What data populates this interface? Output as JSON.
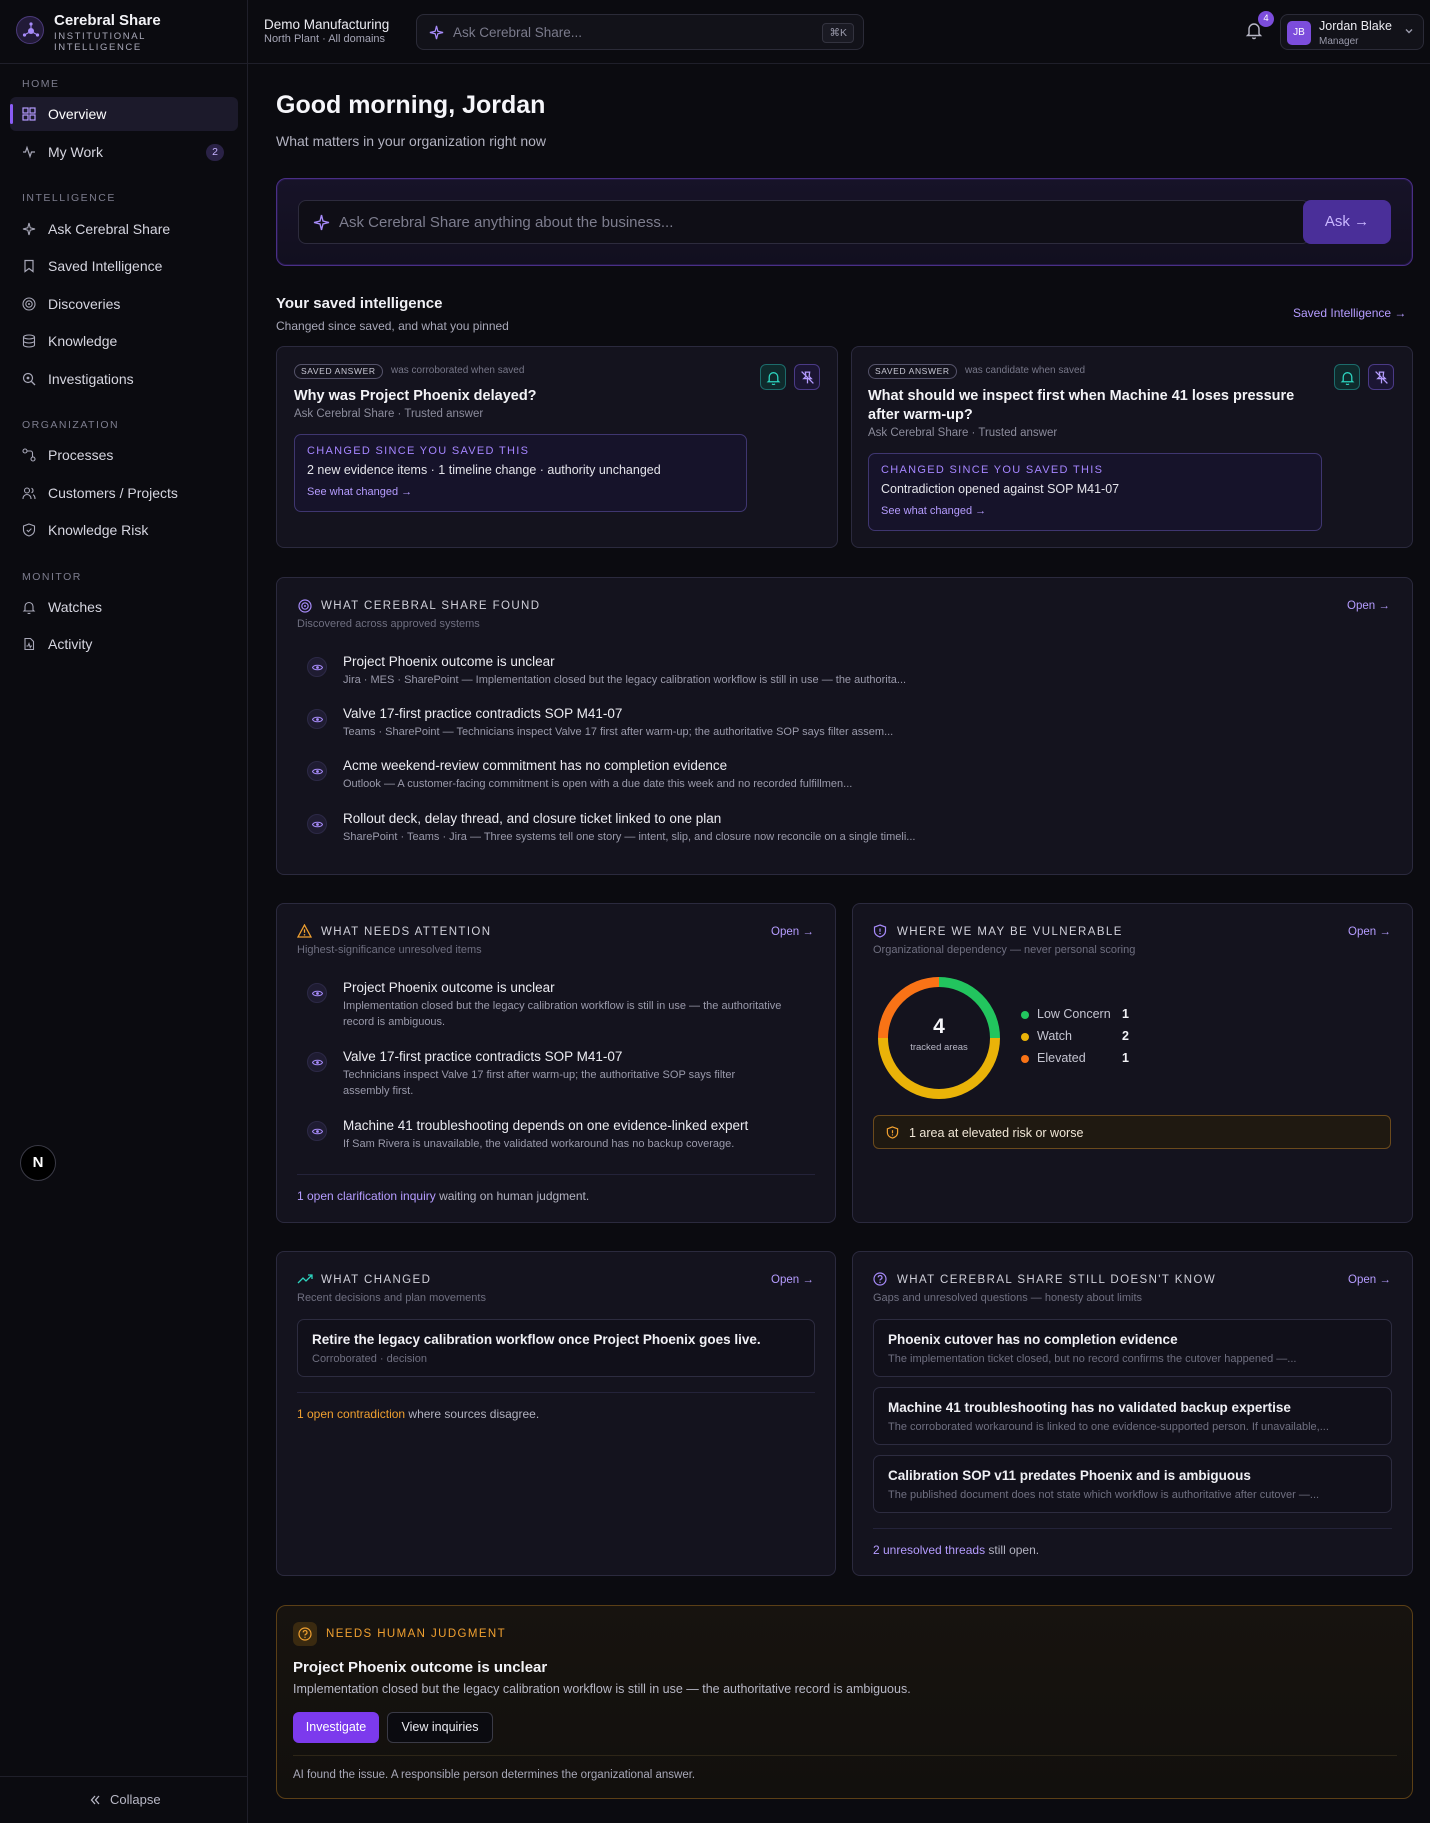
{
  "brand": {
    "name": "Cerebral Share",
    "subtitle": "INSTITUTIONAL INTELLIGENCE"
  },
  "org": {
    "name": "Demo Manufacturing",
    "scope": "North Plant · All domains"
  },
  "search": {
    "placeholder": "Ask Cerebral Share...",
    "shortcut": "⌘K"
  },
  "notifications": {
    "count": "4"
  },
  "user": {
    "initials": "JB",
    "name": "Jordan Blake",
    "role": "Manager"
  },
  "sidebar": {
    "sections": [
      {
        "label": "HOME"
      },
      {
        "label": "INTELLIGENCE"
      },
      {
        "label": "ORGANIZATION"
      },
      {
        "label": "MONITOR"
      }
    ],
    "items": [
      {
        "label": "Overview",
        "icon": "grid-icon"
      },
      {
        "label": "My Work",
        "icon": "activity-icon",
        "badge": "2"
      },
      {
        "label": "Ask Cerebral Share",
        "icon": "sparkle-icon"
      },
      {
        "label": "Saved Intelligence",
        "icon": "bookmark-icon"
      },
      {
        "label": "Discoveries",
        "icon": "radar-icon"
      },
      {
        "label": "Knowledge",
        "icon": "database-icon"
      },
      {
        "label": "Investigations",
        "icon": "search-icon"
      },
      {
        "label": "Processes",
        "icon": "workflow-icon"
      },
      {
        "label": "Customers / Projects",
        "icon": "users-icon"
      },
      {
        "label": "Knowledge Risk",
        "icon": "shield-icon"
      },
      {
        "label": "Watches",
        "icon": "bell-icon"
      },
      {
        "label": "Activity",
        "icon": "file-activity-icon"
      }
    ],
    "collapse_label": "Collapse",
    "next_badge": "N"
  },
  "greeting": {
    "title": "Good morning, Jordan",
    "subtitle": "What matters in your organization right now"
  },
  "ask": {
    "placeholder": "Ask Cerebral Share anything about the business...",
    "button": "Ask →"
  },
  "saved": {
    "title": "Your saved intelligence",
    "subtitle": "Changed since saved, and what you pinned",
    "link": "Saved Intelligence →",
    "cards": [
      {
        "pill": "SAVED ANSWER",
        "note": "was corroborated when saved",
        "title": "Why was Project Phoenix delayed?",
        "source": "Ask Cerebral Share · Trusted answer",
        "changed_heading": "CHANGED SINCE YOU SAVED THIS",
        "changed_text": "2 new evidence items · 1 timeline change · authority unchanged",
        "changed_link": "See what changed →"
      },
      {
        "pill": "SAVED ANSWER",
        "note": "was candidate when saved",
        "title": "What should we inspect first when Machine 41 loses pressure after warm-up?",
        "source": "Ask Cerebral Share · Trusted answer",
        "changed_heading": "CHANGED SINCE YOU SAVED THIS",
        "changed_text": "Contradiction opened against SOP M41-07",
        "changed_link": "See what changed →"
      }
    ]
  },
  "found": {
    "heading": "WHAT CEREBRAL SHARE FOUND",
    "subtitle": "Discovered across approved systems",
    "open": "Open →",
    "items": [
      {
        "title": "Project Phoenix outcome is unclear",
        "desc": "Jira · MES · SharePoint — Implementation closed but the legacy calibration workflow is still in use — the authorita..."
      },
      {
        "title": "Valve 17-first practice contradicts SOP M41-07",
        "desc": "Teams · SharePoint — Technicians inspect Valve 17 first after warm-up; the authoritative SOP says filter assem..."
      },
      {
        "title": "Acme weekend-review commitment has no completion evidence",
        "desc": "Outlook — A customer-facing commitment is open with a due date this week and no recorded fulfillmen..."
      },
      {
        "title": "Rollout deck, delay thread, and closure ticket linked to one plan",
        "desc": "SharePoint · Teams · Jira — Three systems tell one story — intent, slip, and closure now reconcile on a single timeli..."
      }
    ]
  },
  "attention": {
    "heading": "WHAT NEEDS ATTENTION",
    "subtitle": "Highest-significance unresolved items",
    "open": "Open →",
    "items": [
      {
        "title": "Project Phoenix outcome is unclear",
        "desc": "Implementation closed but the legacy calibration workflow is still in use — the authoritative record is ambiguous."
      },
      {
        "title": "Valve 17-first practice contradicts SOP M41-07",
        "desc": "Technicians inspect Valve 17 first after warm-up; the authoritative SOP says filter assembly first."
      },
      {
        "title": "Machine 41 troubleshooting depends on one evidence-linked expert",
        "desc": "If Sam Rivera is unavailable, the validated workaround has no backup coverage."
      }
    ],
    "foot_link": "1 open clarification inquiry",
    "foot_text": " waiting on human judgment."
  },
  "vulnerable": {
    "heading": "WHERE WE MAY BE VULNERABLE",
    "subtitle": "Organizational dependency — never personal scoring",
    "open": "Open →",
    "total": "4",
    "total_label": "tracked areas",
    "alert": "1 area at elevated risk or worse",
    "segments": [
      {
        "name": "Low Concern",
        "count": 1,
        "color": "#22c55e"
      },
      {
        "name": "Watch",
        "count": 2,
        "color": "#eab308"
      },
      {
        "name": "Elevated",
        "count": 1,
        "color": "#f97316"
      }
    ]
  },
  "changed": {
    "heading": "WHAT CHANGED",
    "subtitle": "Recent decisions and plan movements",
    "open": "Open →",
    "items": [
      {
        "title": "Retire the legacy calibration workflow once Project Phoenix goes live.",
        "desc": "Corroborated · decision"
      }
    ],
    "foot_link": "1 open contradiction",
    "foot_text": " where sources disagree."
  },
  "unknown": {
    "heading": "WHAT CEREBRAL SHARE STILL DOESN'T KNOW",
    "subtitle": "Gaps and unresolved questions — honesty about limits",
    "open": "Open →",
    "items": [
      {
        "title": "Phoenix cutover has no completion evidence",
        "desc": "The implementation ticket closed, but no record confirms the cutover happened —..."
      },
      {
        "title": "Machine 41 troubleshooting has no validated backup expertise",
        "desc": "The corroborated workaround is linked to one evidence-supported person. If unavailable,..."
      },
      {
        "title": "Calibration SOP v11 predates Phoenix and is ambiguous",
        "desc": "The published document does not state which workflow is authoritative after cutover —..."
      }
    ],
    "foot_link": "2 unresolved threads",
    "foot_text": " still open."
  },
  "judgment": {
    "heading": "NEEDS HUMAN JUDGMENT",
    "title": "Project Phoenix outcome is unclear",
    "desc": "Implementation closed but the legacy calibration workflow is still in use — the authoritative record is ambiguous.",
    "primary": "Investigate",
    "secondary": "View inquiries",
    "note": "AI found the issue. A responsible person determines the organizational answer."
  },
  "colors": {
    "accent": "#8a5cf5",
    "warning": "#f0a030",
    "teal": "#2dd4bf"
  }
}
